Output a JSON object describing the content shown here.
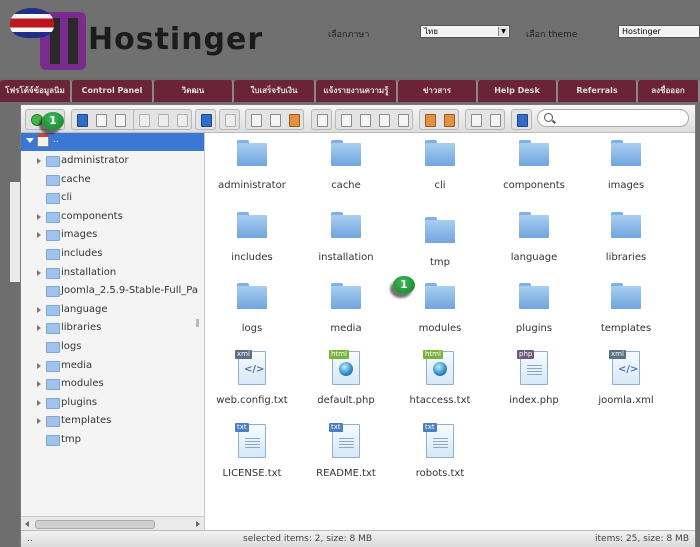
{
  "header": {
    "logo_text": "Hostinger",
    "lang_label": "เลือกภาษา",
    "lang_value": "ไทย",
    "theme_label": "เลือก theme",
    "theme_value": "Hostinger"
  },
  "nav": [
    {
      "label": "โฟรโต้จ์ข้อมูลนิม",
      "w": 72
    },
    {
      "label": "Control Panel",
      "w": 82
    },
    {
      "label": "วิดฒน",
      "w": 80
    },
    {
      "label": "ใบเสร็จรับเงิน",
      "w": 82
    },
    {
      "label": "แจ้งรายงานความรู้",
      "w": 82
    },
    {
      "label": "ข่าวสาร",
      "w": 80
    },
    {
      "label": "Help Desk",
      "w": 80
    },
    {
      "label": "Referrals",
      "w": 80
    },
    {
      "label": "ลงชื่อออก",
      "w": 62
    }
  ],
  "tree": {
    "root_label": "..",
    "items": [
      {
        "label": "administrator",
        "expandable": true
      },
      {
        "label": "cache",
        "expandable": false
      },
      {
        "label": "cli",
        "expandable": false
      },
      {
        "label": "components",
        "expandable": true
      },
      {
        "label": "images",
        "expandable": true
      },
      {
        "label": "includes",
        "expandable": false
      },
      {
        "label": "installation",
        "expandable": true
      },
      {
        "label": "Joomla_2.5.9-Stable-Full_Pa",
        "expandable": false
      },
      {
        "label": "language",
        "expandable": true
      },
      {
        "label": "libraries",
        "expandable": true
      },
      {
        "label": "logs",
        "expandable": false
      },
      {
        "label": "media",
        "expandable": true
      },
      {
        "label": "modules",
        "expandable": true
      },
      {
        "label": "plugins",
        "expandable": true
      },
      {
        "label": "templates",
        "expandable": true
      },
      {
        "label": "tmp",
        "expandable": false
      }
    ]
  },
  "search": {
    "placeholder": ""
  },
  "files": [
    {
      "name": "administrator",
      "type": "folder"
    },
    {
      "name": "cache",
      "type": "folder"
    },
    {
      "name": "cli",
      "type": "folder"
    },
    {
      "name": "components",
      "type": "folder"
    },
    {
      "name": "images",
      "type": "folder"
    },
    {
      "name": "includes",
      "type": "folder"
    },
    {
      "name": "installation",
      "type": "folder"
    },
    {
      "name": "tmp",
      "type": "folder"
    },
    {
      "name": "language",
      "type": "folder"
    },
    {
      "name": "libraries",
      "type": "folder"
    },
    {
      "name": "logs",
      "type": "folder"
    },
    {
      "name": "media",
      "type": "folder"
    },
    {
      "name": "modules",
      "type": "folder"
    },
    {
      "name": "plugins",
      "type": "folder"
    },
    {
      "name": "templates",
      "type": "folder"
    },
    {
      "name": "web.config.txt",
      "type": "xml",
      "badge": "xml"
    },
    {
      "name": "default.php",
      "type": "html",
      "badge": "html"
    },
    {
      "name": "htaccess.txt",
      "type": "html",
      "badge": "html"
    },
    {
      "name": "index.php",
      "type": "php",
      "badge": "php"
    },
    {
      "name": "joomla.xml",
      "type": "xml",
      "badge": "xml"
    },
    {
      "name": "LICENSE.txt",
      "type": "txt",
      "badge": "txt"
    },
    {
      "name": "README.txt",
      "type": "txt",
      "badge": "txt"
    },
    {
      "name": "robots.txt",
      "type": "txt",
      "badge": "txt"
    }
  ],
  "annotations": [
    "1",
    "1"
  ],
  "status": {
    "left": "..",
    "selected": "selected items: 2, size: 8 MB",
    "total": "items: 25, size: 8 MB"
  },
  "colors": {
    "nav_bg": "#6b2338",
    "tree_selected": "#3b78d6",
    "annotation_green": "#1f9a3a"
  }
}
